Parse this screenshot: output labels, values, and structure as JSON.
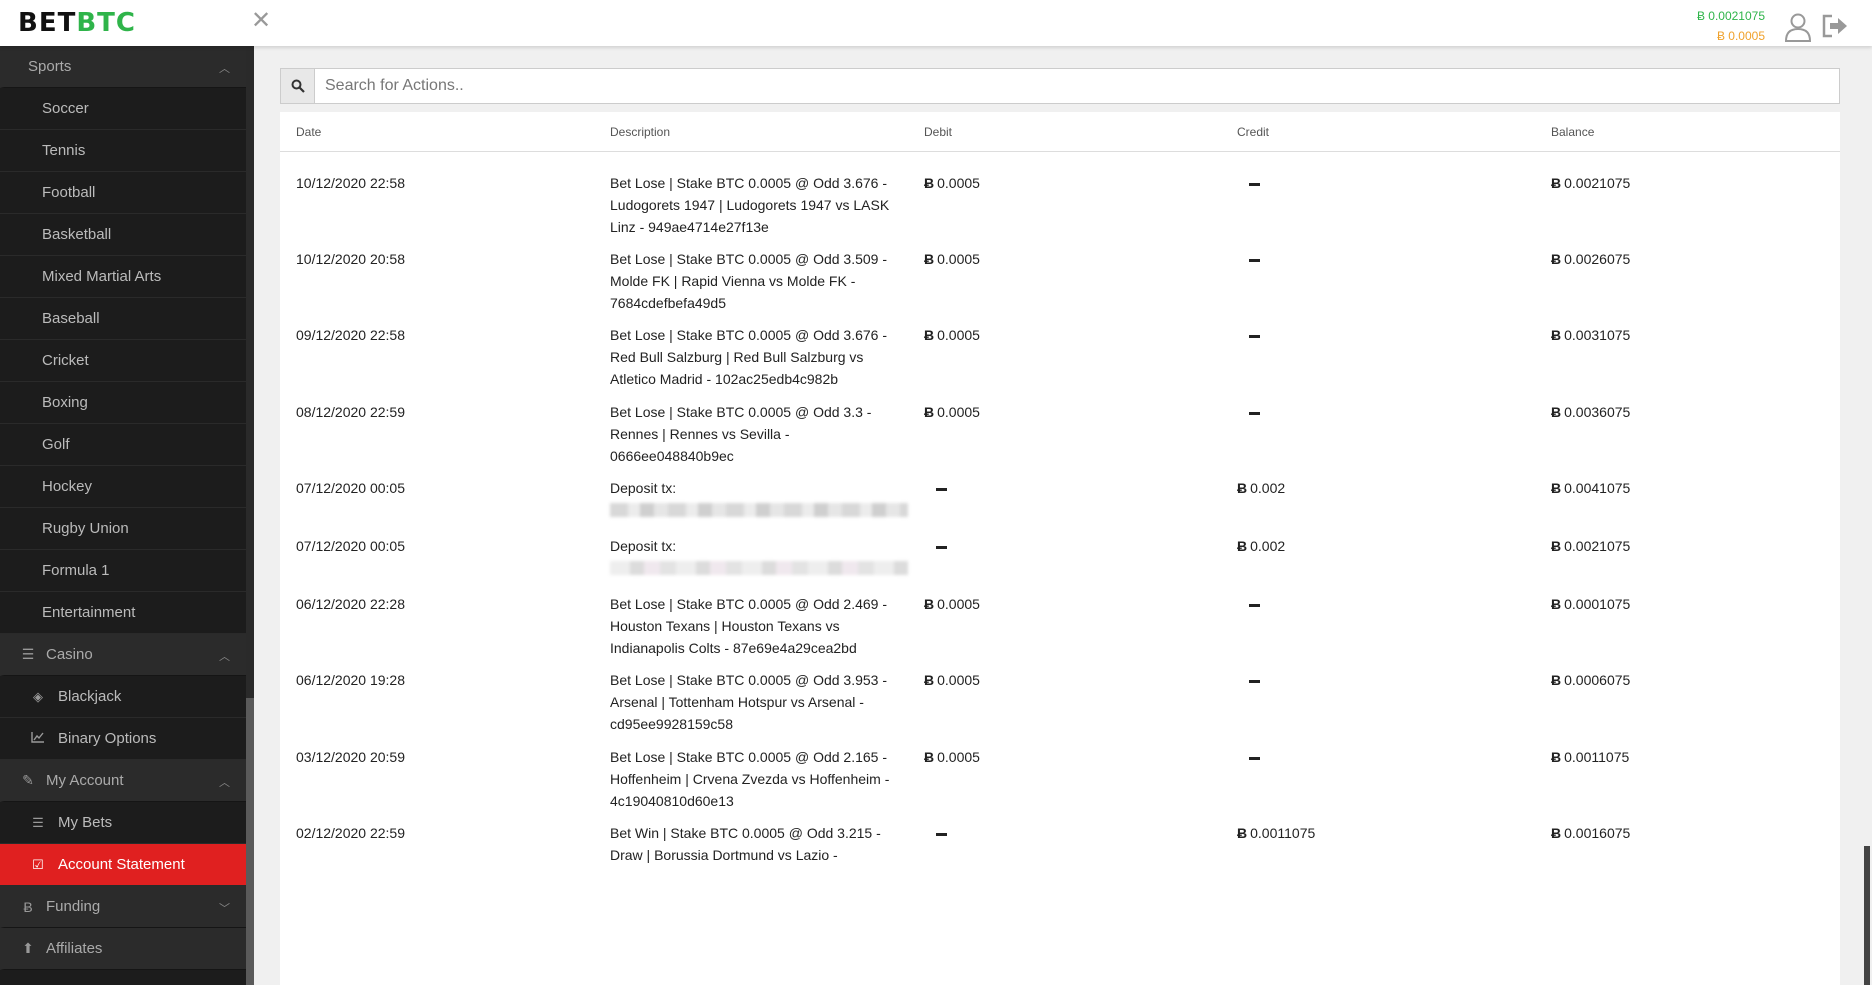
{
  "header": {
    "logo_bet": "BET",
    "logo_btc": "BTC",
    "balance_main": "Ƀ 0.0021075",
    "balance_bonus": "Ƀ 0.0005",
    "close_glyph": "✕"
  },
  "sidebar": {
    "sports": {
      "label": "Sports",
      "items": [
        "Soccer",
        "Tennis",
        "Football",
        "Basketball",
        "Mixed Martial Arts",
        "Baseball",
        "Cricket",
        "Boxing",
        "Golf",
        "Hockey",
        "Rugby Union",
        "Formula 1",
        "Entertainment"
      ]
    },
    "casino": {
      "label": "Casino",
      "items": [
        {
          "label": "Blackjack",
          "icon": "tag-icon"
        },
        {
          "label": "Binary Options",
          "icon": "chart-line-icon"
        }
      ]
    },
    "my_account": {
      "label": "My Account",
      "items": [
        {
          "label": "My Bets",
          "icon": "list-icon"
        },
        {
          "label": "Account Statement",
          "icon": "checkbox-icon",
          "active": true
        }
      ]
    },
    "funding": {
      "label": "Funding",
      "icon": "bitcoin-icon"
    },
    "affiliates": {
      "label": "Affiliates",
      "icon": "arrow-up-circle-icon"
    }
  },
  "search": {
    "placeholder": "Search for Actions.."
  },
  "table": {
    "headers": {
      "date": "Date",
      "description": "Description",
      "debit": "Debit",
      "credit": "Credit",
      "balance": "Balance"
    },
    "rows": [
      {
        "date": "10/12/2020 22:58",
        "desc": "Bet Lose | Stake BTC 0.0005 @ Odd 3.676 - Ludogorets 1947 | Ludogorets 1947 vs LASK Linz - 949ae4714e27f13e",
        "debit": "0.0005",
        "credit": "",
        "balance": "0.0021075"
      },
      {
        "date": "10/12/2020 20:58",
        "desc": "Bet Lose | Stake BTC 0.0005 @ Odd 3.509 - Molde FK | Rapid Vienna vs Molde FK - 7684cdefbefa49d5",
        "debit": "0.0005",
        "credit": "",
        "balance": "0.0026075"
      },
      {
        "date": "09/12/2020 22:58",
        "desc": "Bet Lose | Stake BTC 0.0005 @ Odd 3.676 - Red Bull Salzburg | Red Bull Salzburg vs Atletico Madrid - 102ac25edb4c982b",
        "debit": "0.0005",
        "credit": "",
        "balance": "0.0031075"
      },
      {
        "date": "08/12/2020 22:59",
        "desc": "Bet Lose | Stake BTC 0.0005 @ Odd 3.3 - Rennes | Rennes vs Sevilla - 0666ee048840b9ec",
        "debit": "0.0005",
        "credit": "",
        "balance": "0.0036075"
      },
      {
        "date": "07/12/2020 00:05",
        "desc": "Deposit tx:",
        "debit": "",
        "credit": "0.002",
        "balance": "0.0041075"
      },
      {
        "date": "07/12/2020 00:05",
        "desc": "Deposit tx:",
        "debit": "",
        "credit": "0.002",
        "balance": "0.0021075"
      },
      {
        "date": "06/12/2020 22:28",
        "desc": "Bet Lose | Stake BTC 0.0005 @ Odd 2.469 - Houston Texans | Houston Texans vs Indianapolis Colts - 87e69e4a29cea2bd",
        "debit": "0.0005",
        "credit": "",
        "balance": "0.0001075"
      },
      {
        "date": "06/12/2020 19:28",
        "desc": "Bet Lose | Stake BTC 0.0005 @ Odd 3.953 - Arsenal | Tottenham Hotspur vs Arsenal - cd95ee9928159c58",
        "debit": "0.0005",
        "credit": "",
        "balance": "0.0006075"
      },
      {
        "date": "03/12/2020 20:59",
        "desc": "Bet Lose | Stake BTC 0.0005 @ Odd 2.165 - Hoffenheim | Crvena Zvezda vs Hoffenheim - 4c19040810d60e13",
        "debit": "0.0005",
        "credit": "",
        "balance": "0.0011075"
      },
      {
        "date": "02/12/2020 22:59",
        "desc": "Bet Win | Stake BTC 0.0005 @ Odd 3.215 - Draw | Borussia Dortmund vs Lazio -",
        "debit": "",
        "credit": "0.0011075",
        "balance": "0.0016075"
      }
    ]
  },
  "colors": {
    "accent_red": "#e02020",
    "btc_green": "#2fb44a",
    "bonus_orange": "#f0a12b",
    "sidebar_bg": "#1c1c1c"
  }
}
